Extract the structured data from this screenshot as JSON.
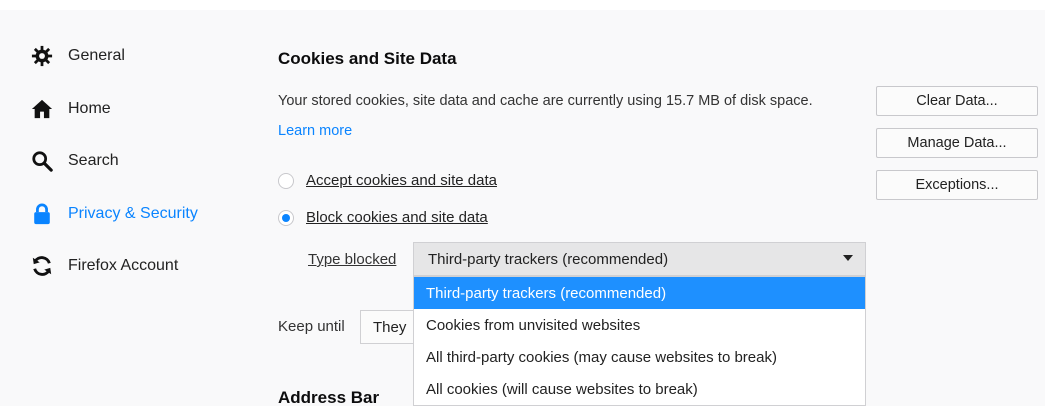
{
  "sidebar": {
    "items": [
      {
        "label": "General",
        "icon": "gear-icon"
      },
      {
        "label": "Home",
        "icon": "home-icon"
      },
      {
        "label": "Search",
        "icon": "search-icon"
      },
      {
        "label": "Privacy & Security",
        "icon": "lock-icon",
        "active": true
      },
      {
        "label": "Firefox Account",
        "icon": "sync-icon"
      }
    ]
  },
  "cookies": {
    "title": "Cookies and Site Data",
    "description": "Your stored cookies, site data and cache are currently using 15.7 MB of disk space.",
    "learn_more": "Learn more",
    "buttons": {
      "clear": "Clear Data...",
      "manage": "Manage Data...",
      "exceptions": "Exceptions..."
    },
    "options": {
      "accept": "Accept cookies and site data",
      "block": "Block cookies and site data",
      "selected": "block"
    },
    "type_blocked_label": "Type blocked",
    "type_blocked_value": "Third-party trackers (recommended)",
    "keep_until_label": "Keep until",
    "keep_until_value": "They",
    "dropdown_options": [
      "Third-party trackers (recommended)",
      "Cookies from unvisited websites",
      "All third-party cookies (may cause websites to break)",
      "All cookies (will cause websites to break)"
    ]
  },
  "address_bar": {
    "title": "Address Bar"
  },
  "colors": {
    "accent": "#0a84ff",
    "selection": "#1e90ff"
  }
}
